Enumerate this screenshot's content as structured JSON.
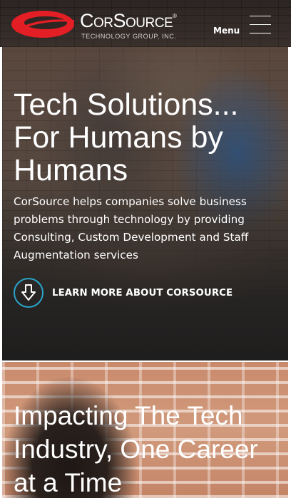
{
  "header": {
    "brand_name": "CorSource",
    "brand_reg": "®",
    "brand_tagline": "TECHNOLOGY GROUP, INC.",
    "menu_label": "Menu",
    "logo_color": "#e31e24"
  },
  "hero": {
    "heading": "Tech Solutions... For Humans by Humans",
    "text": "CorSource helps companies solve business problems through technology by providing Consulting, Custom Development and Staff Augmentation services",
    "cta_label": "LEARN MORE ABOUT CORSOURCE",
    "cta_icon": "arrow-down-icon",
    "accent_color": "#29a5c9"
  },
  "hero2": {
    "heading": "Impacting The Tech Industry, One Career at a Time"
  }
}
